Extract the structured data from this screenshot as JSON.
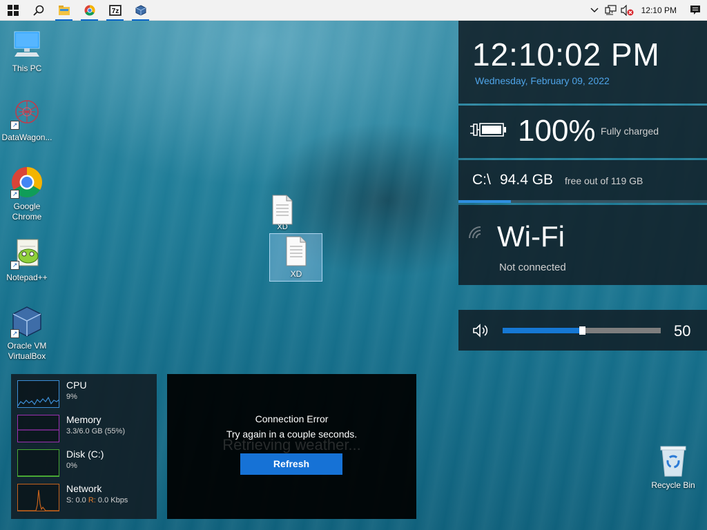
{
  "taskbar": {
    "apps": [
      {
        "name": "start",
        "icon": "windows-logo"
      },
      {
        "name": "search",
        "icon": "search-icon"
      },
      {
        "name": "file-explorer",
        "icon": "folder-icon"
      },
      {
        "name": "chrome",
        "icon": "chrome-icon"
      },
      {
        "name": "7zip",
        "icon": "7zip-icon",
        "label": "7z"
      },
      {
        "name": "virtualbox",
        "icon": "virtualbox-icon"
      }
    ],
    "clock": "12:10 PM"
  },
  "desktop_icons": [
    {
      "label": "This PC",
      "icon": "computer-icon"
    },
    {
      "label": "DataWagon...",
      "icon": "datawagon-icon"
    },
    {
      "label": "Google Chrome",
      "icon": "chrome-icon"
    },
    {
      "label": "Notepad++",
      "icon": "notepadpp-icon"
    },
    {
      "label": "Oracle VM VirtualBox",
      "icon": "virtualbox-icon"
    },
    {
      "label": "XD",
      "icon": "document-icon"
    },
    {
      "label": "XD",
      "icon": "document-icon"
    },
    {
      "label": "Recycle Bin",
      "icon": "recycle-bin-icon"
    }
  ],
  "clock_gadget": {
    "time": "12:10:02 PM",
    "date": "Wednesday, February 09, 2022"
  },
  "battery_gadget": {
    "percent": "100%",
    "status": "Fully charged"
  },
  "disk_gadget": {
    "drive": "C:\\",
    "free": "94.4 GB",
    "detail": "free out of 119 GB",
    "used_fraction": 0.21
  },
  "wifi_gadget": {
    "name": "Wi-Fi",
    "status": "Not connected"
  },
  "volume_gadget": {
    "value": "50",
    "level_fraction": 0.5
  },
  "perf_gadget": {
    "rows": [
      {
        "title": "CPU",
        "sub_text": "9%",
        "color": "#3c8ed6"
      },
      {
        "title": "Memory",
        "sub_text": "3.3/6.0 GB (55%)",
        "color": "#9b2fb0"
      },
      {
        "title": "Disk (C:)",
        "sub_text": "0%",
        "color": "#48a834"
      },
      {
        "title": "Network",
        "sub_s_label": "S:",
        "sub_s": "0.0",
        "sub_r_label": "R:",
        "sub_r": "0.0 Kbps",
        "color": "#c5621c"
      }
    ]
  },
  "weather_gadget": {
    "ghost_text": "Retrieving weather...",
    "error_title": "Connection Error",
    "error_message": "Try again in a couple seconds.",
    "refresh_label": "Refresh"
  }
}
